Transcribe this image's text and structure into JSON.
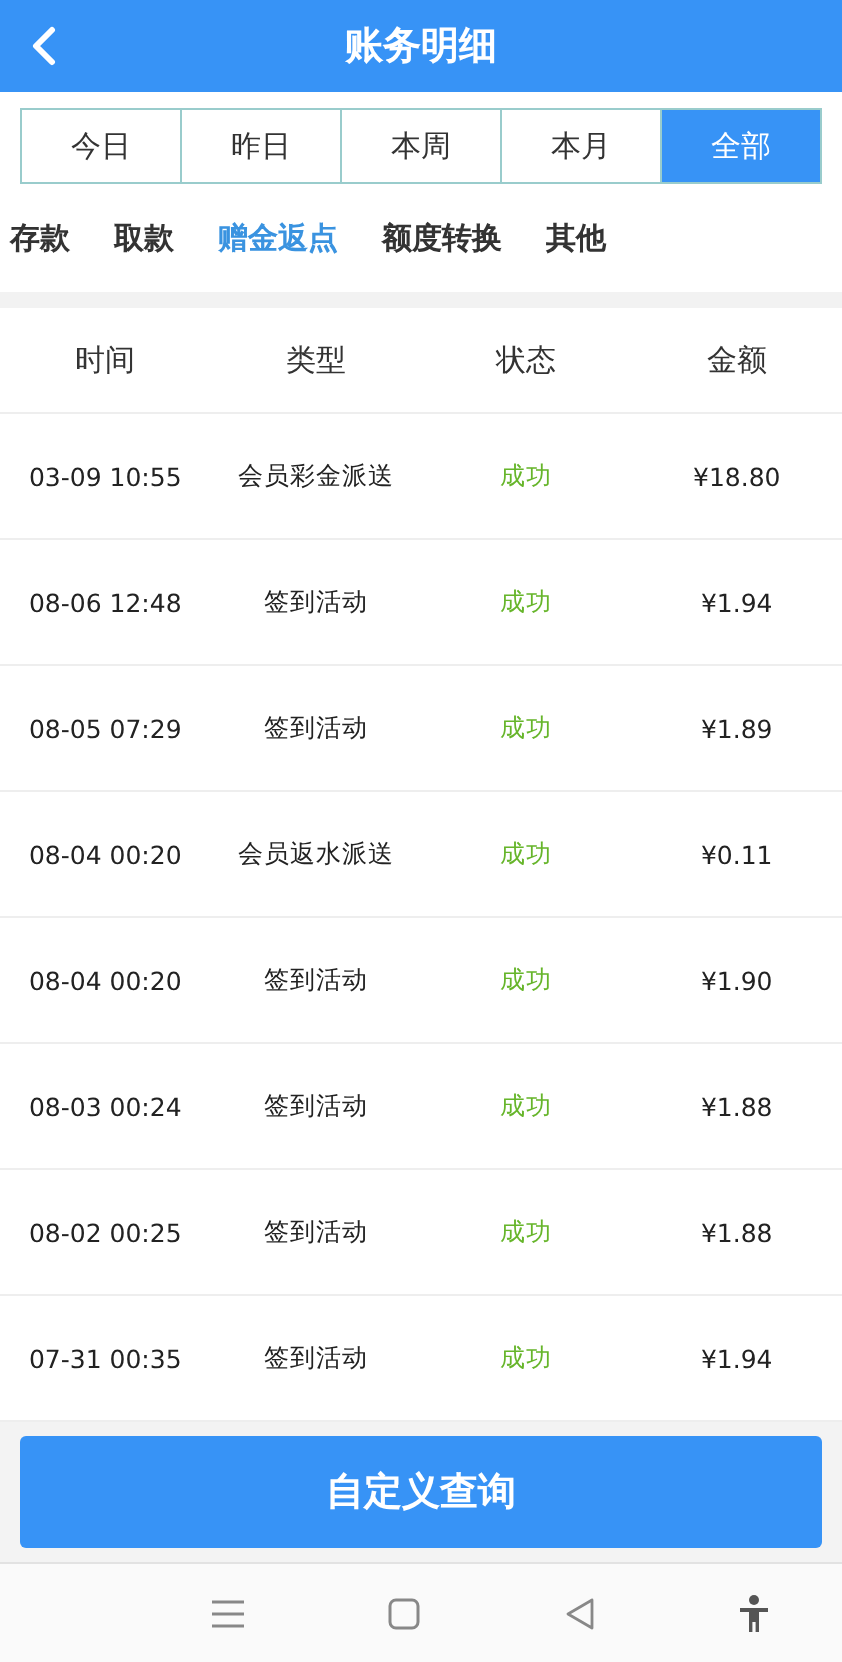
{
  "header": {
    "title": "账务明细"
  },
  "period_tabs": [
    {
      "label": "今日",
      "selected": false
    },
    {
      "label": "昨日",
      "selected": false
    },
    {
      "label": "本周",
      "selected": false
    },
    {
      "label": "本月",
      "selected": false
    },
    {
      "label": "全部",
      "selected": true
    }
  ],
  "category_tabs": [
    {
      "label": "存款",
      "selected": false
    },
    {
      "label": "取款",
      "selected": false
    },
    {
      "label": "赠金返点",
      "selected": true
    },
    {
      "label": "额度转换",
      "selected": false
    },
    {
      "label": "其他",
      "selected": false
    }
  ],
  "table": {
    "columns": [
      "时间",
      "类型",
      "状态",
      "金额"
    ],
    "rows": [
      [
        "03-09 10:55",
        "会员彩金派送",
        "成功",
        "¥18.80"
      ],
      [
        "08-06 12:48",
        "签到活动",
        "成功",
        "¥1.94"
      ],
      [
        "08-05 07:29",
        "签到活动",
        "成功",
        "¥1.89"
      ],
      [
        "08-04 00:20",
        "会员返水派送",
        "成功",
        "¥0.11"
      ],
      [
        "08-04 00:20",
        "签到活动",
        "成功",
        "¥1.90"
      ],
      [
        "08-03 00:24",
        "签到活动",
        "成功",
        "¥1.88"
      ],
      [
        "08-02 00:25",
        "签到活动",
        "成功",
        "¥1.88"
      ],
      [
        "07-31 00:35",
        "签到活动",
        "成功",
        "¥1.94"
      ]
    ]
  },
  "query_button": "自定义查询"
}
